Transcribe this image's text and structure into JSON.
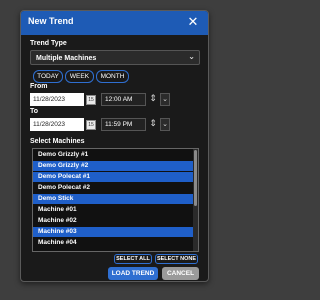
{
  "dialog": {
    "title": "New Trend",
    "close_icon": "close-icon"
  },
  "trend_type": {
    "label": "Trend Type",
    "value": "Multiple Machines",
    "icon": "chevron-down-icon"
  },
  "range_buttons": [
    {
      "label": "TODAY"
    },
    {
      "label": "WEEK"
    },
    {
      "label": "MONTH"
    }
  ],
  "from": {
    "label": "From",
    "date": "11/28/2023",
    "time": "12:00 AM",
    "calendar_icon": "calendar-icon"
  },
  "to": {
    "label": "To",
    "date": "11/28/2023",
    "time": "11:59 PM",
    "calendar_icon": "calendar-icon"
  },
  "machines": {
    "label": "Select Machines",
    "items": [
      {
        "name": "Demo Grizzly #1",
        "selected": false
      },
      {
        "name": "Demo Grizzly #2",
        "selected": true
      },
      {
        "name": "Demo Polecat #1",
        "selected": true
      },
      {
        "name": "Demo Polecat #2",
        "selected": false
      },
      {
        "name": "Demo Stick",
        "selected": true
      },
      {
        "name": "Machine #01",
        "selected": false
      },
      {
        "name": "Machine #02",
        "selected": false
      },
      {
        "name": "Machine #03",
        "selected": true
      },
      {
        "name": "Machine #04",
        "selected": false
      }
    ],
    "select_all": "SELECT ALL",
    "select_none": "SELECT NONE"
  },
  "actions": {
    "load": "LOAD TREND",
    "cancel": "CANCEL"
  },
  "colors": {
    "accent": "#1e5bb5",
    "button": "#2f6fd1",
    "selected_row": "#1f5fc9",
    "cancel": "#9a9a9a",
    "background": "#1a1a1a"
  }
}
